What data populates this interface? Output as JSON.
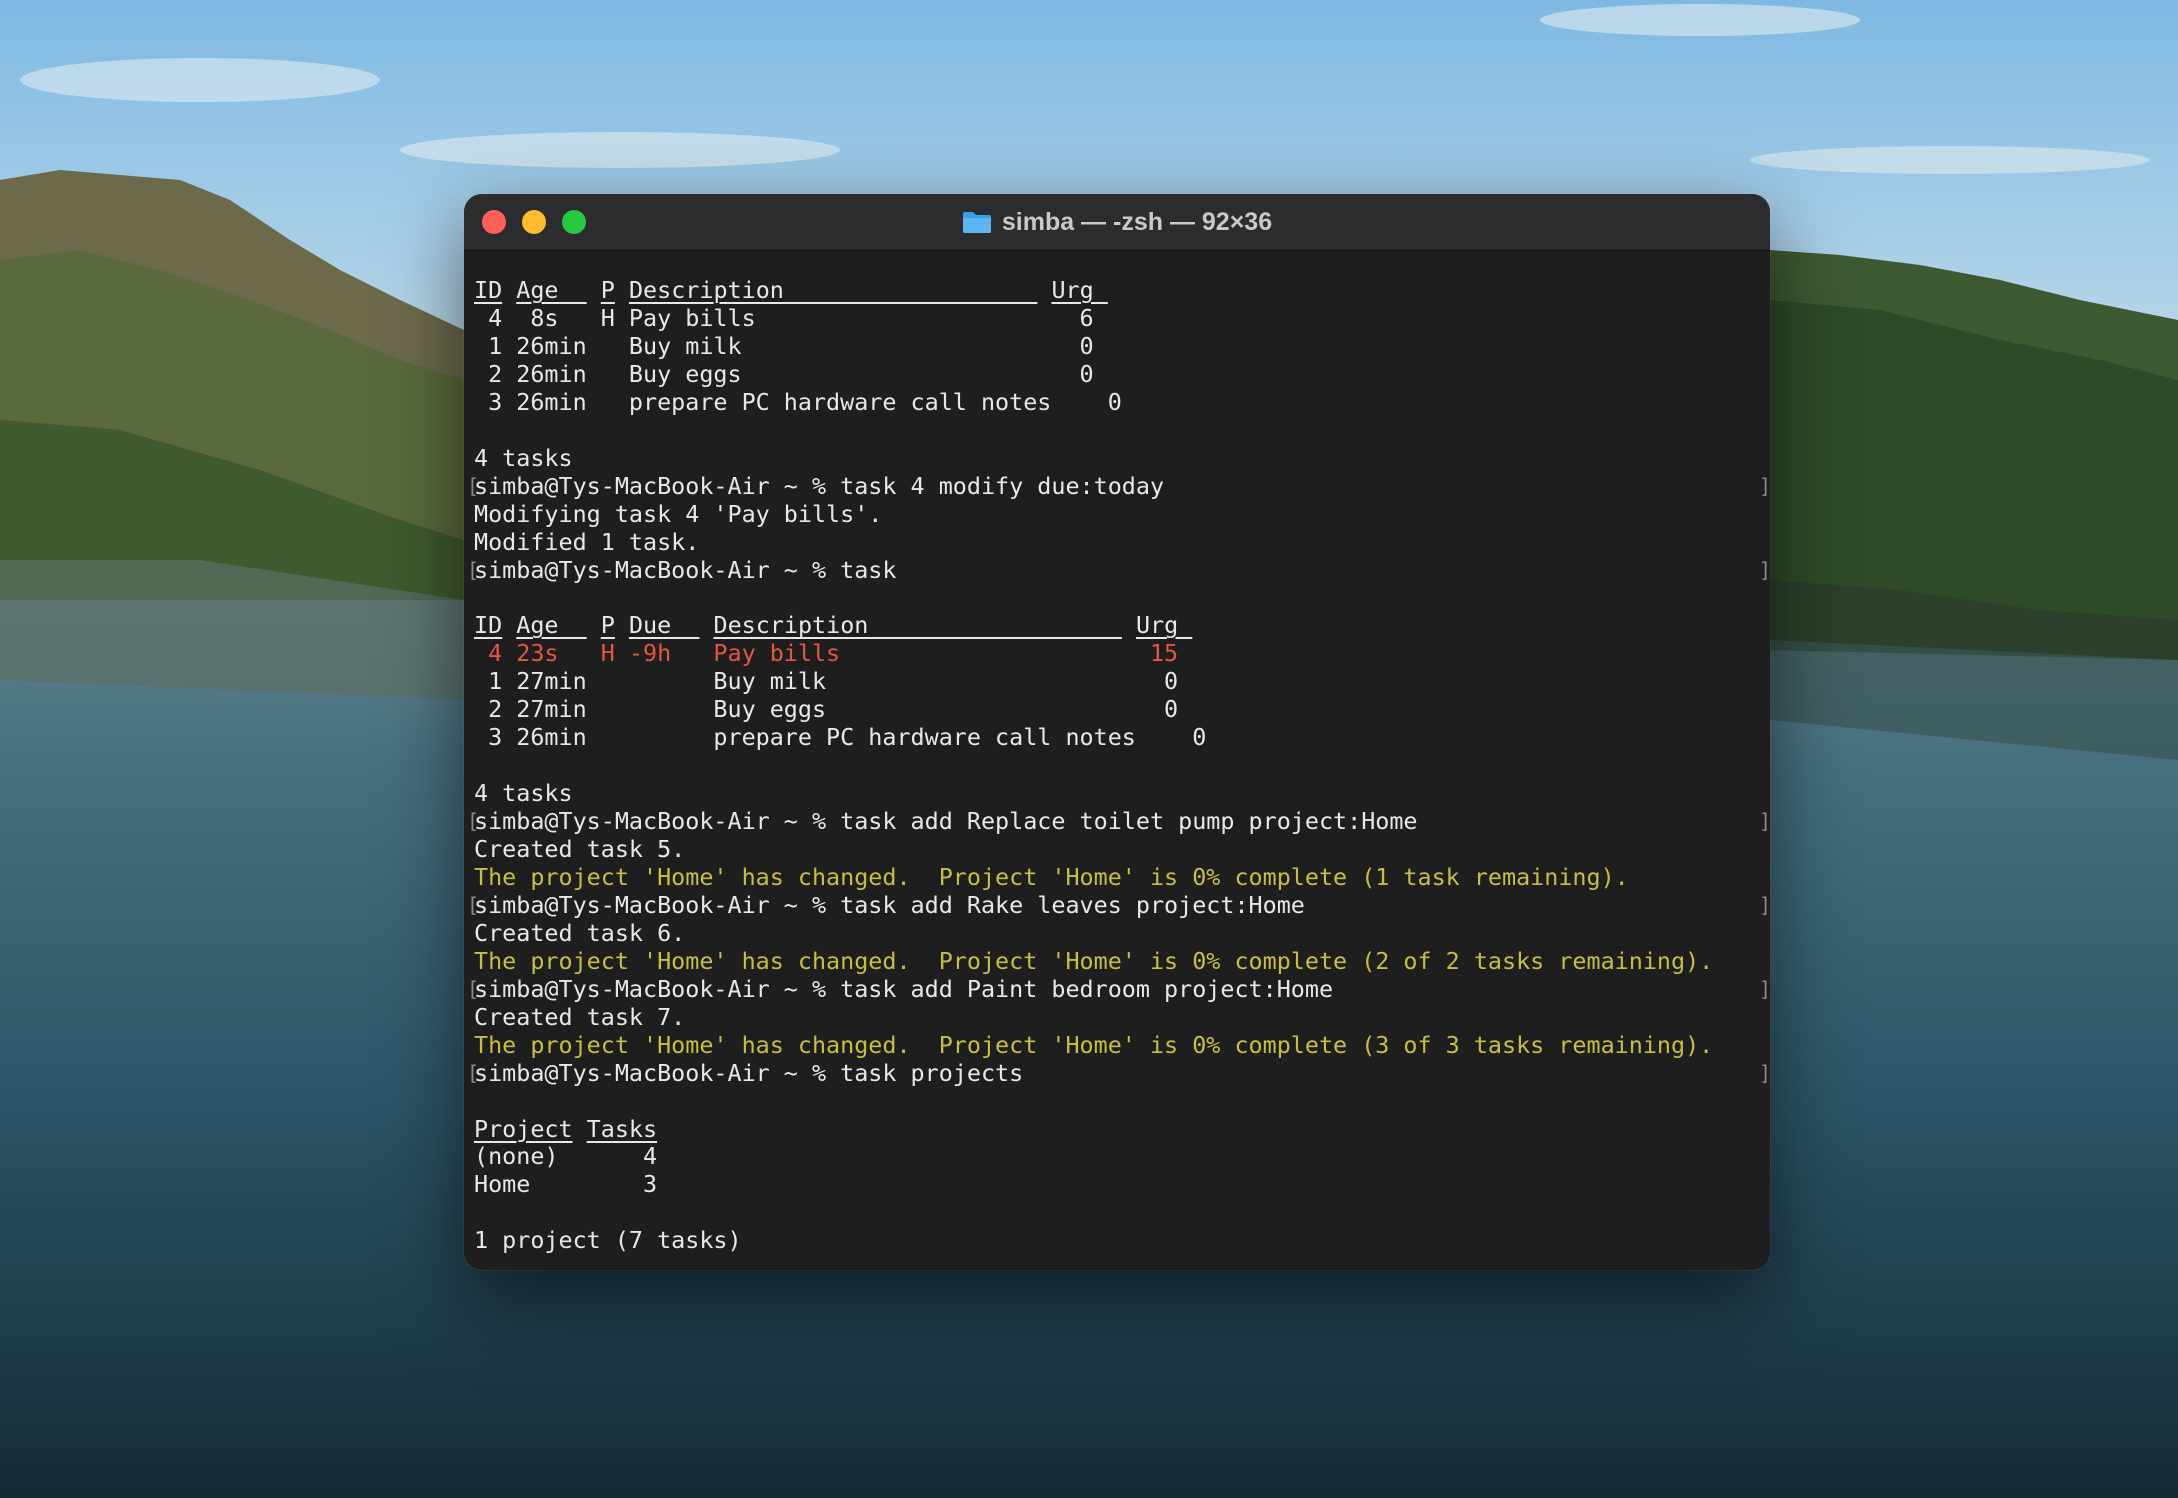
{
  "window": {
    "title": "simba — -zsh — 92×36"
  },
  "terminal": {
    "lines": [
      {
        "segments": [
          {
            "t": "ID",
            "u": true
          },
          {
            "t": " "
          },
          {
            "t": "Age  ",
            "u": true
          },
          {
            "t": " "
          },
          {
            "t": "P",
            "u": true
          },
          {
            "t": " "
          },
          {
            "t": "Description                  ",
            "u": true
          },
          {
            "t": " "
          },
          {
            "t": "Urg ",
            "u": true
          }
        ]
      },
      {
        "segments": [
          {
            "t": " 4  8s   H Pay bills                       6"
          }
        ]
      },
      {
        "segments": [
          {
            "t": " 1 26min   Buy milk                        0"
          }
        ]
      },
      {
        "segments": [
          {
            "t": " 2 26min   Buy eggs                        0"
          }
        ]
      },
      {
        "segments": [
          {
            "t": " 3 26min   prepare PC hardware call notes    0"
          }
        ]
      },
      {
        "segments": []
      },
      {
        "segments": [
          {
            "t": "4 tasks"
          }
        ]
      },
      {
        "prompt": true,
        "segments": [
          {
            "t": "simba@Tys-MacBook-Air ~ % task 4 modify due:today"
          }
        ]
      },
      {
        "segments": [
          {
            "t": "Modifying task 4 'Pay bills'."
          }
        ]
      },
      {
        "segments": [
          {
            "t": "Modified 1 task."
          }
        ]
      },
      {
        "prompt": true,
        "segments": [
          {
            "t": "simba@Tys-MacBook-Air ~ % task"
          }
        ]
      },
      {
        "segments": []
      },
      {
        "segments": [
          {
            "t": "ID",
            "u": true
          },
          {
            "t": " "
          },
          {
            "t": "Age  ",
            "u": true
          },
          {
            "t": " "
          },
          {
            "t": "P",
            "u": true
          },
          {
            "t": " "
          },
          {
            "t": "Due  ",
            "u": true
          },
          {
            "t": " "
          },
          {
            "t": "Description                  ",
            "u": true
          },
          {
            "t": " "
          },
          {
            "t": "Urg ",
            "u": true
          }
        ]
      },
      {
        "segments": [
          {
            "t": " 4 23s   H -9h   Pay bills                      15",
            "c": "red"
          }
        ]
      },
      {
        "segments": [
          {
            "t": " 1 27min         Buy milk                        0"
          }
        ]
      },
      {
        "segments": [
          {
            "t": " 2 27min         Buy eggs                        0"
          }
        ]
      },
      {
        "segments": [
          {
            "t": " 3 26min         prepare PC hardware call notes    0"
          }
        ]
      },
      {
        "segments": []
      },
      {
        "segments": [
          {
            "t": "4 tasks"
          }
        ]
      },
      {
        "prompt": true,
        "segments": [
          {
            "t": "simba@Tys-MacBook-Air ~ % task add Replace toilet pump project:Home"
          }
        ]
      },
      {
        "segments": [
          {
            "t": "Created task 5."
          }
        ]
      },
      {
        "segments": [
          {
            "t": "The project 'Home' has changed.  Project 'Home' is 0% complete (1 task remaining).",
            "c": "yellow"
          }
        ]
      },
      {
        "prompt": true,
        "segments": [
          {
            "t": "simba@Tys-MacBook-Air ~ % task add Rake leaves project:Home"
          }
        ]
      },
      {
        "segments": [
          {
            "t": "Created task 6."
          }
        ]
      },
      {
        "segments": [
          {
            "t": "The project 'Home' has changed.  Project 'Home' is 0% complete (2 of 2 tasks remaining).",
            "c": "yellow"
          }
        ]
      },
      {
        "prompt": true,
        "segments": [
          {
            "t": "simba@Tys-MacBook-Air ~ % task add Paint bedroom project:Home"
          }
        ]
      },
      {
        "segments": [
          {
            "t": "Created task 7."
          }
        ]
      },
      {
        "segments": [
          {
            "t": "The project 'Home' has changed.  Project 'Home' is 0% complete (3 of 3 tasks remaining).",
            "c": "yellow"
          }
        ]
      },
      {
        "prompt": true,
        "segments": [
          {
            "t": "simba@Tys-MacBook-Air ~ % task projects"
          }
        ]
      },
      {
        "segments": []
      },
      {
        "segments": [
          {
            "t": "Project",
            "u": true
          },
          {
            "t": " "
          },
          {
            "t": "Tasks",
            "u": true
          }
        ]
      },
      {
        "segments": [
          {
            "t": "(none)      4"
          }
        ]
      },
      {
        "segments": [
          {
            "t": "Home        3"
          }
        ]
      },
      {
        "segments": []
      },
      {
        "segments": [
          {
            "t": "1 project (7 tasks)"
          }
        ]
      }
    ]
  }
}
